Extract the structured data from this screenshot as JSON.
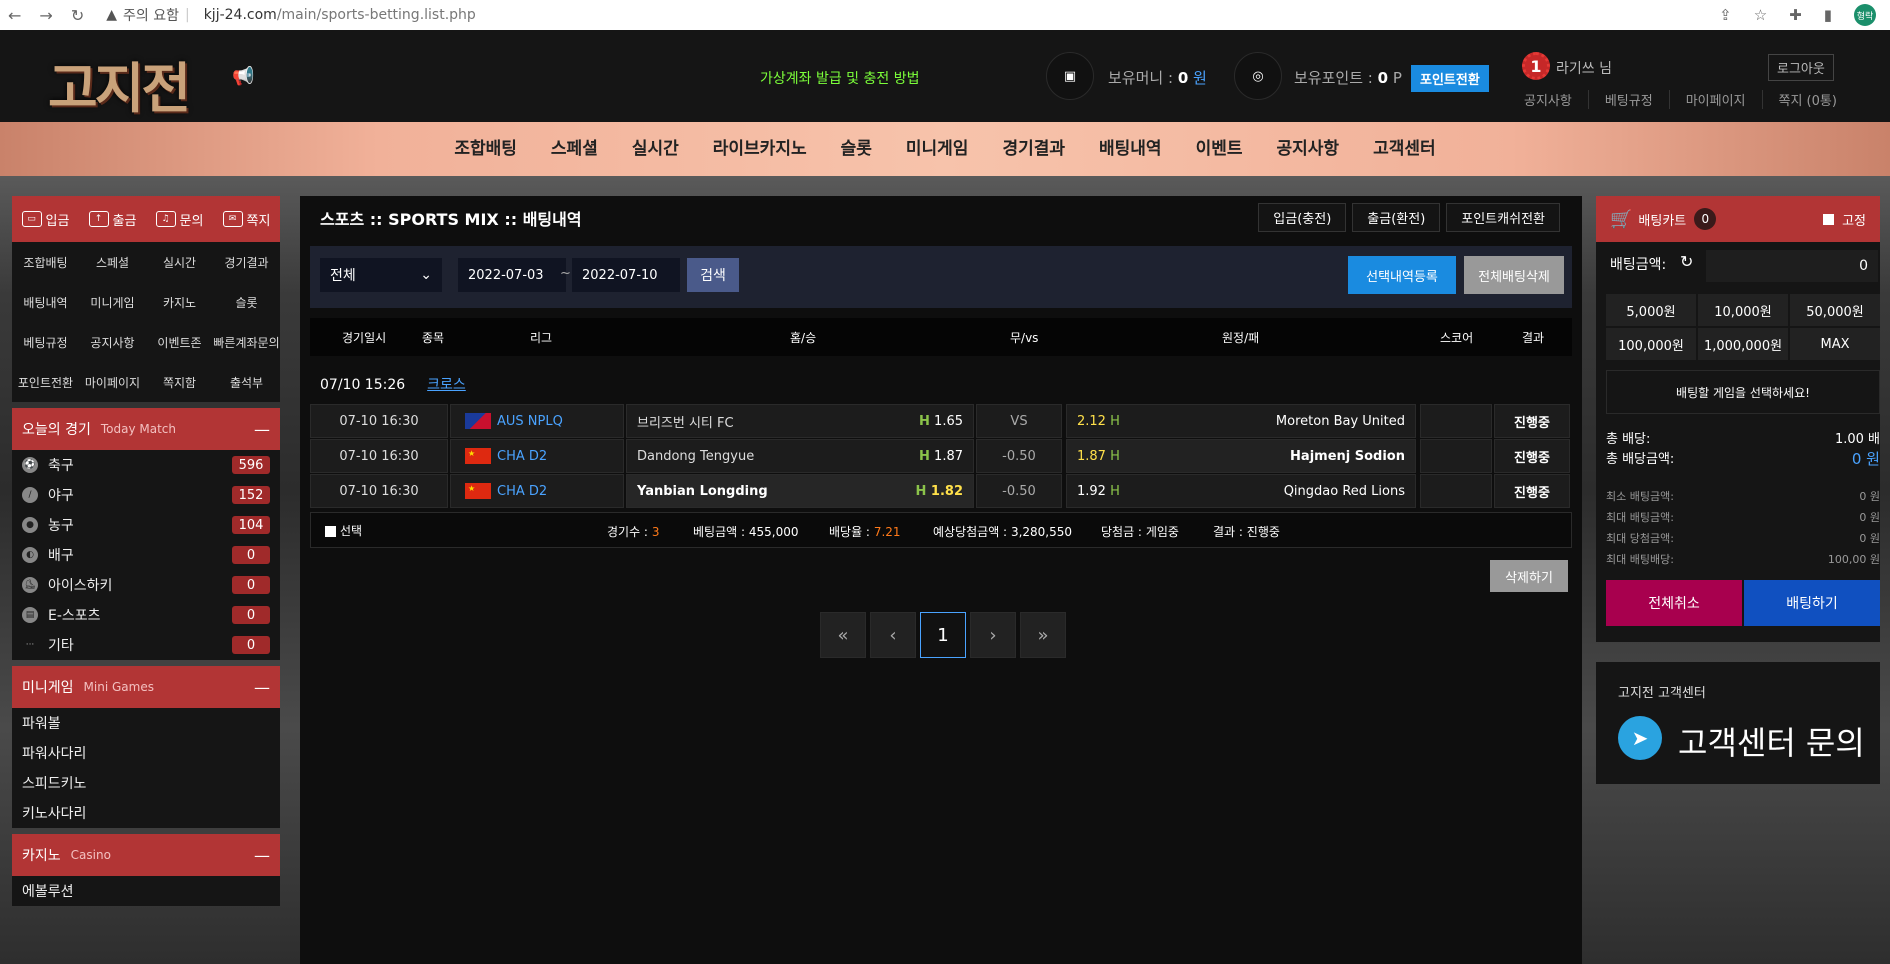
{
  "browser": {
    "warning": "주의 요함",
    "url_host": "kjj-24.com",
    "url_path": "/main/sports-betting.list.php",
    "profile": "형락"
  },
  "header": {
    "logo": "고지전",
    "marquee": "가상계좌 발급 및 충전 방법",
    "money_label": "보유머니 :",
    "money_value": "0",
    "money_unit": "원",
    "point_label": "보유포인트 :",
    "point_value": "0",
    "point_unit": "P",
    "point_convert": "포인트전환",
    "rank": "1",
    "username": "라기쓰 님",
    "logout": "로그아웃",
    "links": [
      "공지사항",
      "베팅규정",
      "마이페이지",
      "쪽지 (0통)"
    ]
  },
  "mainnav": [
    "조합배팅",
    "스페셜",
    "실시간",
    "라이브카지노",
    "슬롯",
    "미니게임",
    "경기결과",
    "배팅내역",
    "이벤트",
    "공지사항",
    "고객센터"
  ],
  "left": {
    "quick": [
      "입금",
      "출금",
      "문의",
      "쪽지"
    ],
    "grid": [
      "조합배팅",
      "스페셜",
      "실시간",
      "경기결과",
      "배팅내역",
      "미니게임",
      "카지노",
      "슬롯",
      "베팅규정",
      "공지사항",
      "이벤트존",
      "빠른계좌문의",
      "포인트전환",
      "마이페이지",
      "쪽지함",
      "출석부"
    ],
    "today": {
      "title": "오늘의 경기",
      "sub": "Today Match"
    },
    "sports": [
      {
        "name": "축구",
        "count": "596"
      },
      {
        "name": "야구",
        "count": "152"
      },
      {
        "name": "농구",
        "count": "104"
      },
      {
        "name": "배구",
        "count": "0"
      },
      {
        "name": "아이스하키",
        "count": "0"
      },
      {
        "name": "E-스포츠",
        "count": "0"
      },
      {
        "name": "기타",
        "count": "0"
      }
    ],
    "mini": {
      "title": "미니게임",
      "sub": "Mini Games"
    },
    "mini_items": [
      "파워볼",
      "파워사다리",
      "스피드키노",
      "키노사다리"
    ],
    "casino": {
      "title": "카지노",
      "sub": "Casino"
    },
    "casino_items": [
      "에볼루션"
    ]
  },
  "center": {
    "title": "스포츠 :: SPORTS MIX :: 배팅내역",
    "top_buttons": [
      "입금(충전)",
      "출금(환전)",
      "포인트캐쉬전환"
    ],
    "filter": {
      "select": "전체",
      "date_from": "2022-07-03",
      "tilde": "~",
      "date_to": "2022-07-10",
      "search": "검색",
      "register": "선택내역등록",
      "delete_all": "전체배팅삭제"
    },
    "columns": [
      "경기일시",
      "종목",
      "리그",
      "홈/승",
      "무/vs",
      "원정/패",
      "스코어",
      "결과"
    ],
    "bet_time": "07/10  15:26",
    "bet_type": "크로스",
    "rows": [
      {
        "time": "07-10 16:30",
        "league": "AUS NPLQ",
        "flag": "au",
        "home": "브리즈번 시티 FC",
        "h_mark": "H",
        "home_odd": "1.65",
        "mid": "VS",
        "away_odd": "2.12",
        "a_mark": "H",
        "away": "Moreton Bay United",
        "status": "진행중"
      },
      {
        "time": "07-10 16:30",
        "league": "CHA D2",
        "flag": "cn",
        "home": "Dandong Tengyue",
        "h_mark": "H",
        "home_odd": "1.87",
        "mid": "-0.50",
        "away_odd": "1.87",
        "a_mark": "H",
        "away": "Hajmenj Sodion",
        "status": "진행중"
      },
      {
        "time": "07-10 16:30",
        "league": "CHA D2",
        "flag": "cn",
        "home": "Yanbian Longding",
        "h_mark": "H",
        "home_odd": "1.82",
        "mid": "-0.50",
        "away_odd": "1.92",
        "a_mark": "H",
        "away": "Qingdao Red Lions",
        "status": "진행중"
      }
    ],
    "summary": {
      "select": "선택",
      "games_label": "경기수 :",
      "games": "3",
      "amount_label": "베팅금액 :",
      "amount": "455,000",
      "rate_label": "배당율 :",
      "rate": "7.21",
      "expect_label": "예상당첨금액 :",
      "expect": "3,280,550",
      "win_label": "당첨금 :",
      "win": "게임중",
      "result_label": "결과 :",
      "result": "진행중"
    },
    "delete": "삭제하기",
    "pager": [
      "«",
      "‹",
      "1",
      "›",
      "»"
    ]
  },
  "cart": {
    "title": "배팅카트",
    "count": "0",
    "fix": "고정",
    "amount_label": "배팅금액:",
    "amount_value": "0",
    "amounts": [
      "5,000원",
      "10,000원",
      "50,000원",
      "100,000원",
      "1,000,000원",
      "MAX"
    ],
    "select_msg": "배팅할 게임을 선택하세요!",
    "total_odds_label": "총 배당:",
    "total_odds": "1.00 배",
    "total_amount_label": "총 배당금액:",
    "total_amount": "0 원",
    "min_label": "최소 배팅금액:",
    "min": "0 원",
    "max_label": "최대 배팅금액:",
    "max": "0 원",
    "maxwin_label": "최대 당첨금액:",
    "maxwin": "0 원",
    "maxodds_label": "최대 배팅배당:",
    "maxodds": "100,00 원",
    "cancel": "전체취소",
    "bet": "배팅하기"
  },
  "support": {
    "label": "고지전 고객센터",
    "title": "고객센터 문의"
  }
}
